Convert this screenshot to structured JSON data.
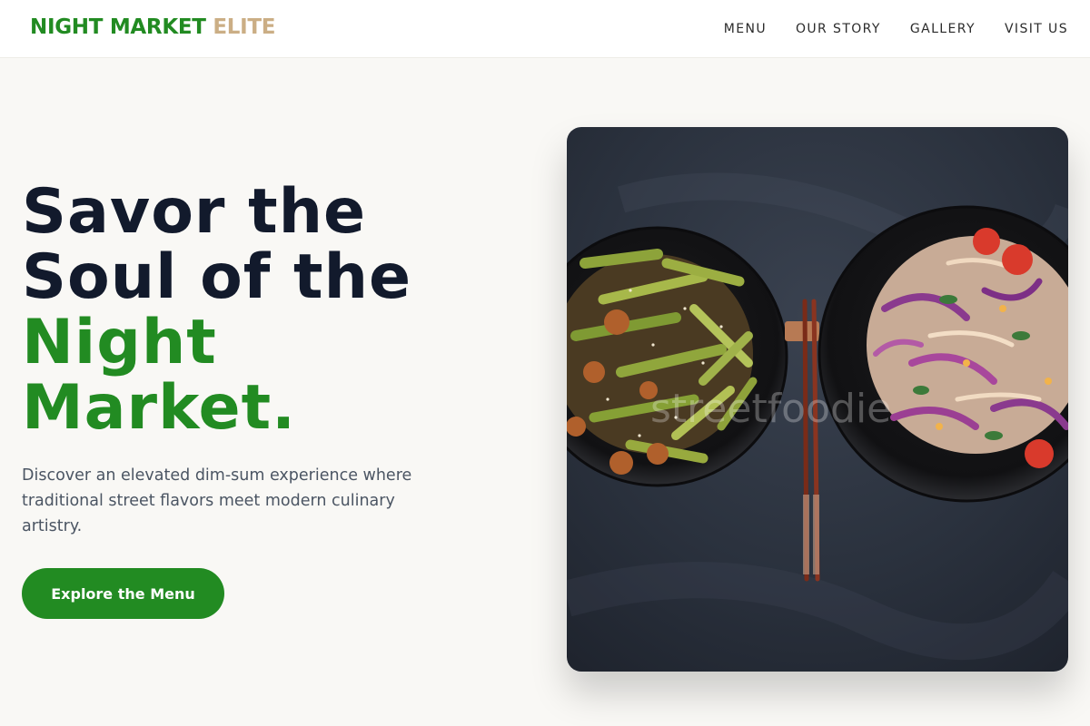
{
  "brand": {
    "part1": "NIGHT MARKET",
    "part2": "ELITE"
  },
  "nav": {
    "items": [
      {
        "label": "MENU"
      },
      {
        "label": "OUR STORY"
      },
      {
        "label": "GALLERY"
      },
      {
        "label": "VISIT US"
      }
    ]
  },
  "hero": {
    "title_line1": "Savor the",
    "title_line2": "Soul of the",
    "title_line3": "Night",
    "title_line4": "Market.",
    "description": "Discover an elevated dim-sum experience where traditional street flavors meet modern culinary artistry.",
    "cta_label": "Explore the Menu"
  },
  "image": {
    "watermark": "streetfoodie"
  },
  "colors": {
    "accent": "#228b22",
    "gold": "#cbae85",
    "heading": "#121a2c",
    "background": "#f9f8f5"
  }
}
